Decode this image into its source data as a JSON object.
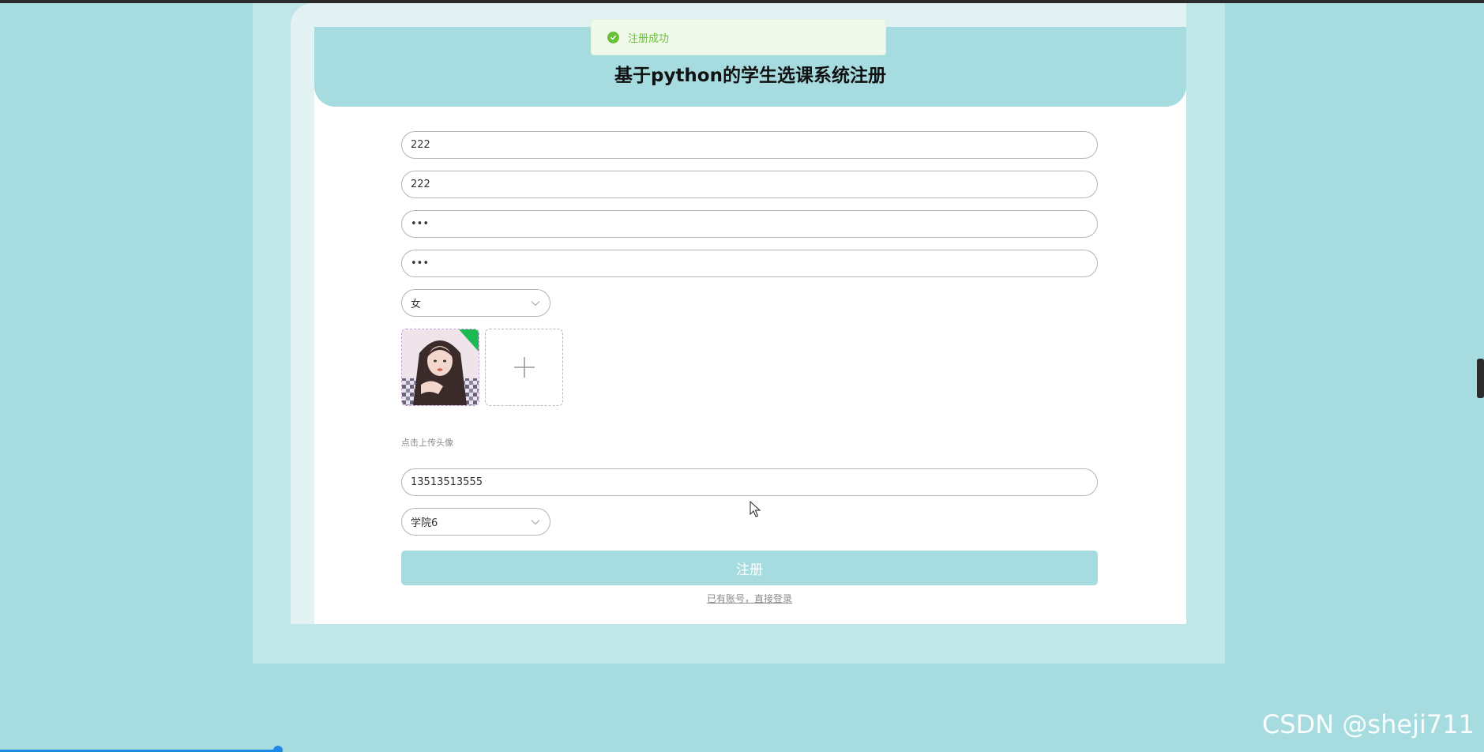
{
  "page": {
    "title": "基于python的学生选课系统注册"
  },
  "toast": {
    "message": "注册成功",
    "icon": "check-circle-icon",
    "color": "#67c23a"
  },
  "form": {
    "fields": [
      {
        "name": "account",
        "value": "222"
      },
      {
        "name": "name",
        "value": "222"
      },
      {
        "name": "password",
        "value": "•••"
      },
      {
        "name": "confirm-password",
        "value": "•••"
      }
    ],
    "gender": {
      "selected": "女"
    },
    "avatar": {
      "hint": "点击上传头像",
      "add_icon": "plus-icon"
    },
    "phone": {
      "value": "13513513555"
    },
    "college": {
      "selected": "学院6"
    },
    "submit_label": "注册",
    "login_link": "已有账号，直接登录"
  },
  "watermark": "CSDN @sheji711",
  "colors": {
    "accent": "#a6dcdf",
    "success": "#67c23a"
  }
}
